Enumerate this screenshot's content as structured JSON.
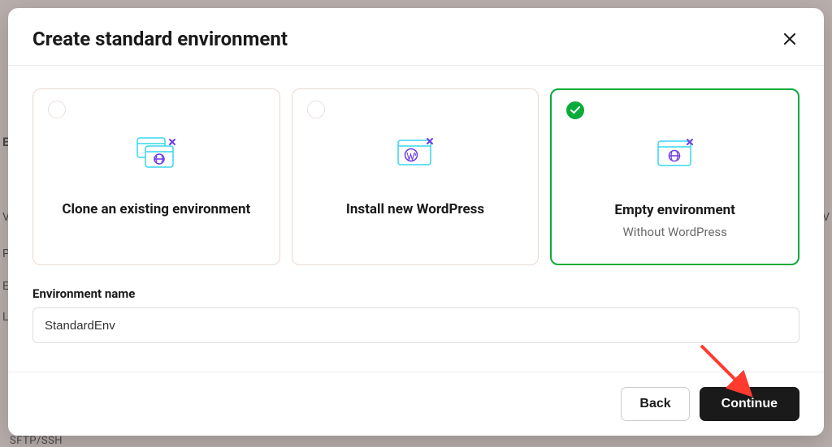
{
  "modal": {
    "title": "Create standard environment",
    "options": [
      {
        "title": "Clone an existing environment",
        "subtitle": "",
        "selected": false,
        "icon": "clone"
      },
      {
        "title": "Install new WordPress",
        "subtitle": "",
        "selected": false,
        "icon": "wordpress"
      },
      {
        "title": "Empty environment",
        "subtitle": "Without WordPress",
        "selected": true,
        "icon": "empty"
      }
    ],
    "field_label": "Environment name",
    "env_name_value": "StandardEnv",
    "back_label": "Back",
    "continue_label": "Continue"
  },
  "backdrop": {
    "t1": "E",
    "t2": "V",
    "t3": "P",
    "t4": "E",
    "t5": "L",
    "t6": "SFTP/SSH",
    "t7": "V"
  }
}
